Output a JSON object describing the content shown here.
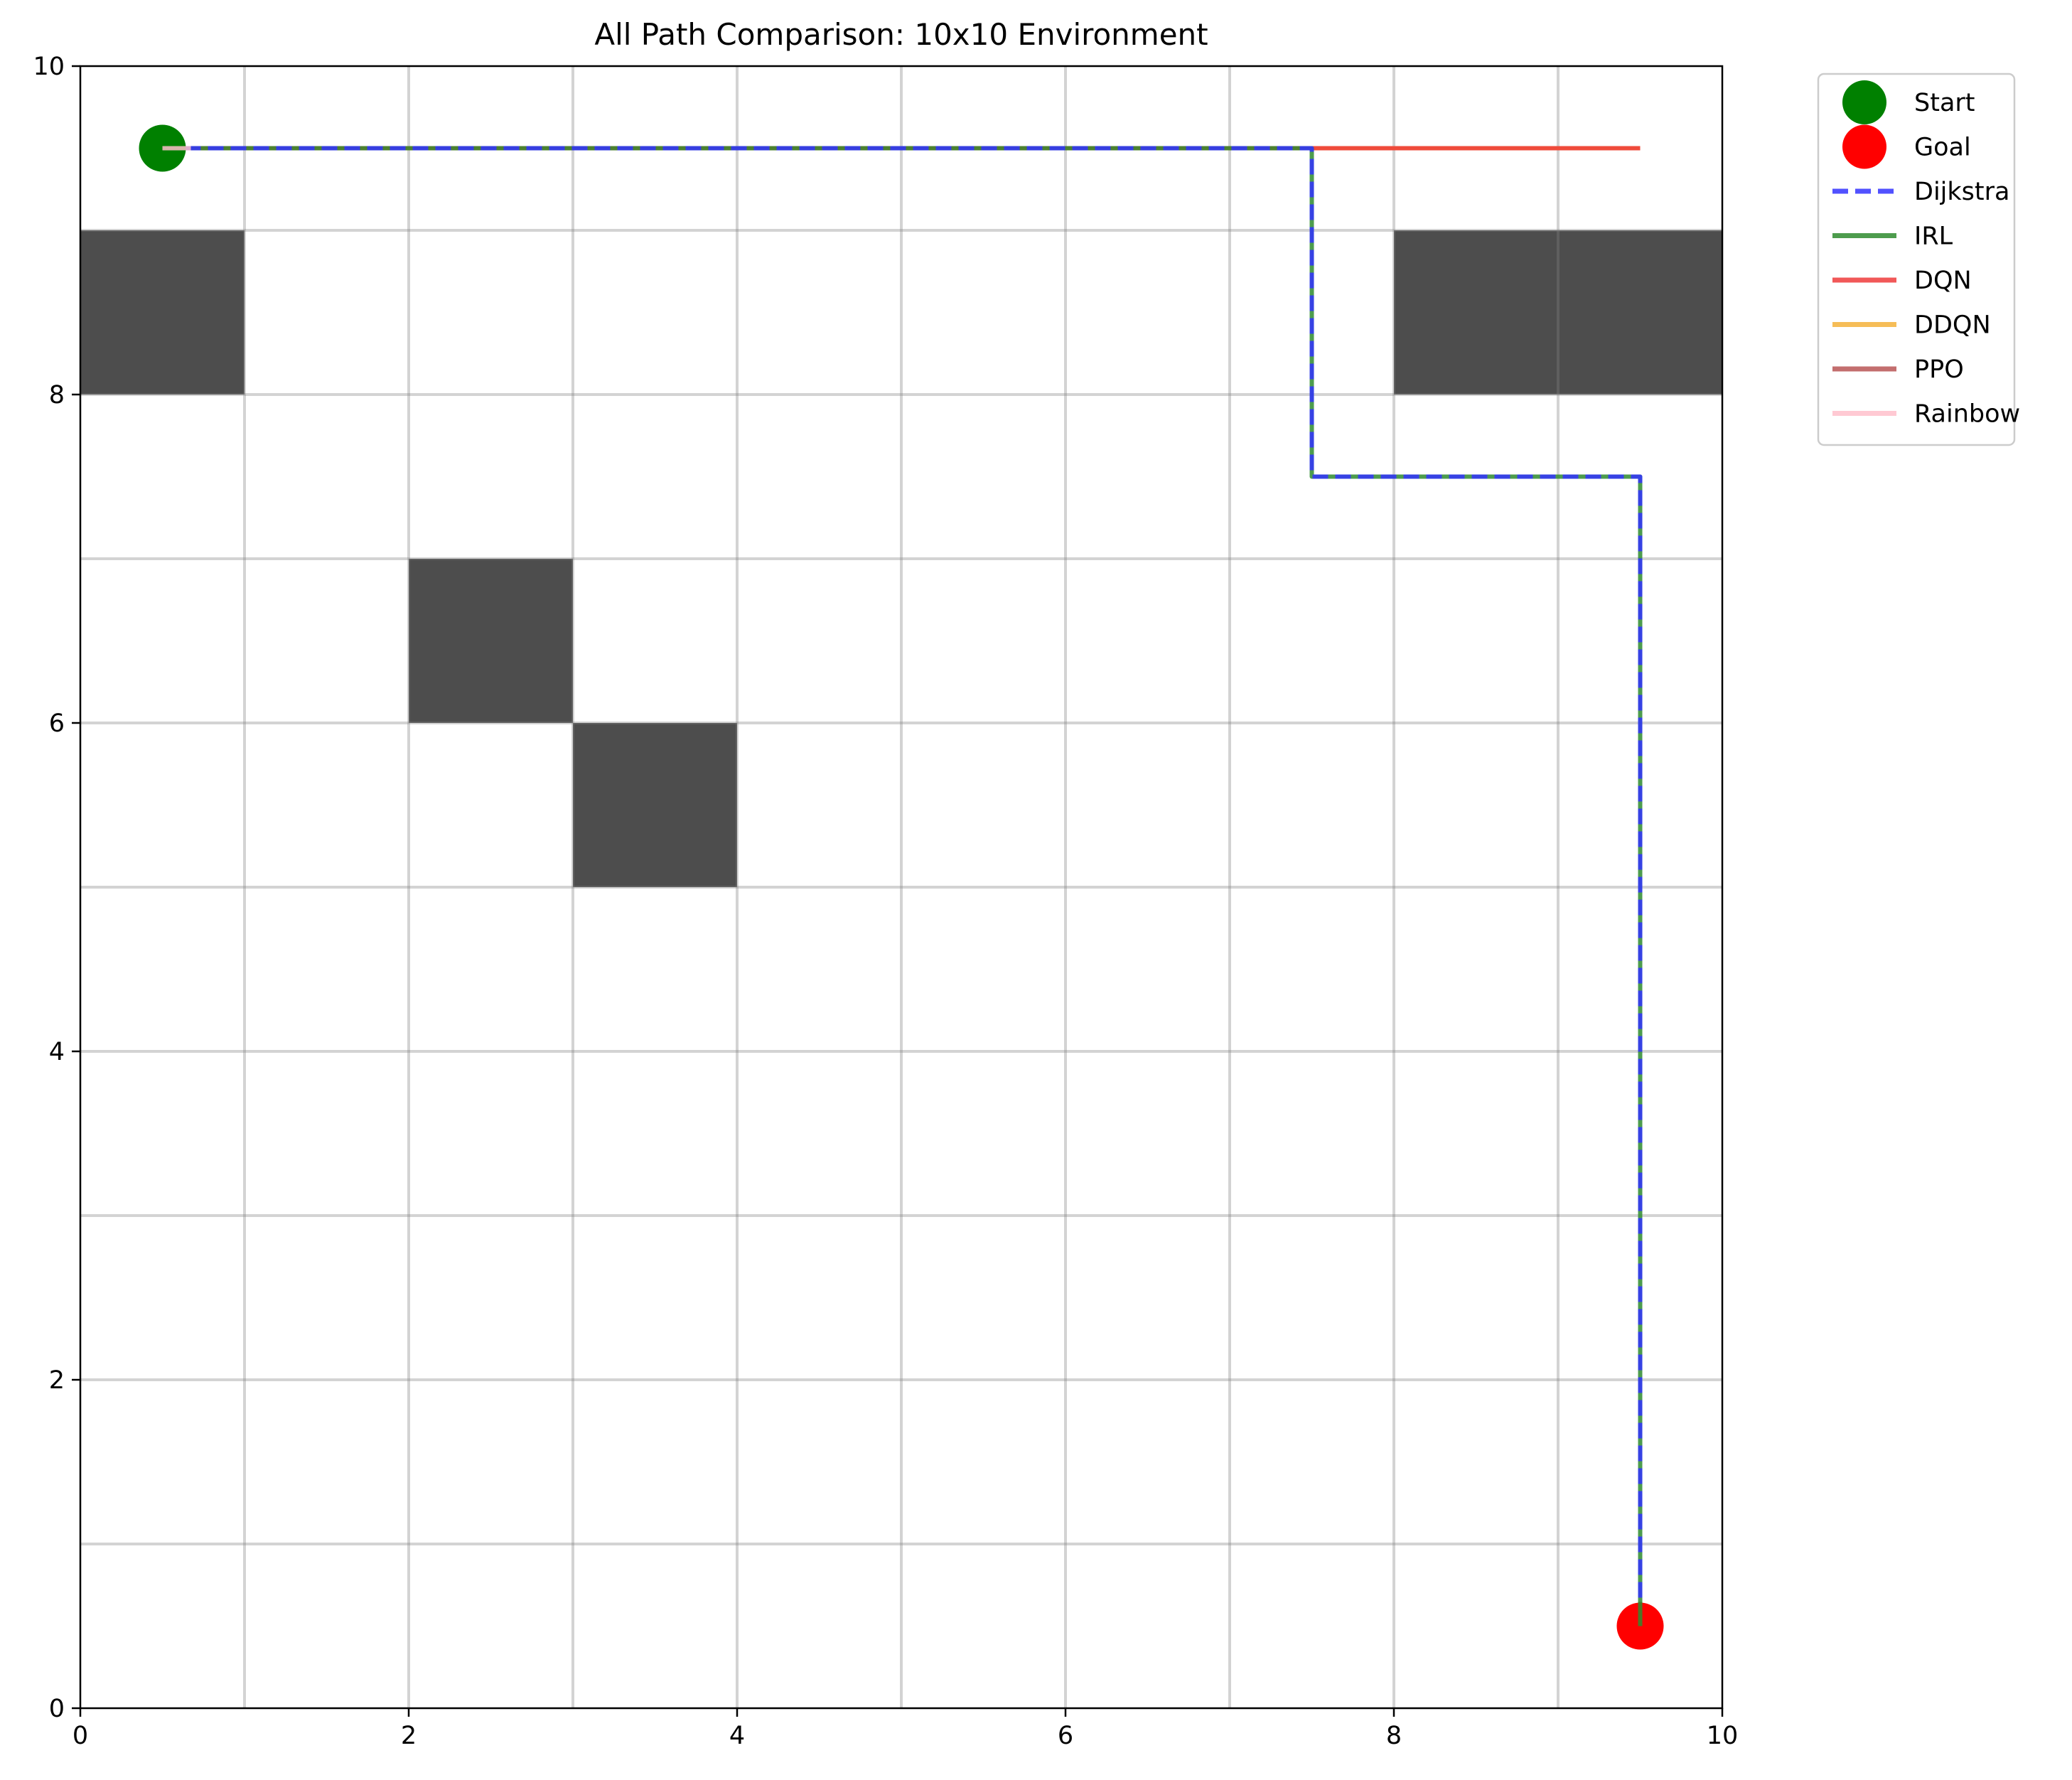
{
  "chart_data": {
    "type": "line",
    "title": "All Path Comparison: 10x10 Environment",
    "xlabel": "",
    "ylabel": "",
    "xlim": [
      0,
      10
    ],
    "ylim": [
      0,
      10
    ],
    "xticks": [
      "0",
      "2",
      "4",
      "6",
      "8",
      "10"
    ],
    "yticks": [
      "0",
      "2",
      "4",
      "6",
      "8",
      "10"
    ],
    "grid": true,
    "grid_step": 1,
    "legend_position": "outside-upper-right",
    "obstacles": [
      {
        "x": 0,
        "y": 8,
        "w": 1,
        "h": 1
      },
      {
        "x": 8,
        "y": 8,
        "w": 2,
        "h": 1
      },
      {
        "x": 2,
        "y": 6,
        "w": 1,
        "h": 1
      },
      {
        "x": 3,
        "y": 5,
        "w": 1,
        "h": 1
      }
    ],
    "obstacle_color": "#4d4d4d",
    "start": {
      "label": "Start",
      "x": 0.5,
      "y": 9.5,
      "color": "#008000"
    },
    "goal": {
      "label": "Goal",
      "x": 9.5,
      "y": 0.5,
      "color": "#ff0000"
    },
    "series": [
      {
        "name": "Dijkstra",
        "color": "#3333ff",
        "dashed": true,
        "x": [
          0.5,
          7.5,
          7.5,
          9.5,
          9.5
        ],
        "y": [
          9.5,
          9.5,
          7.5,
          7.5,
          0.5
        ]
      },
      {
        "name": "IRL",
        "color": "#2e8b2e",
        "dashed": false,
        "x": [
          0.5,
          7.5,
          7.5,
          9.5,
          9.5
        ],
        "y": [
          9.5,
          9.5,
          7.5,
          7.5,
          0.5
        ]
      },
      {
        "name": "DQN",
        "color": "#ee3b3b",
        "dashed": false,
        "x": [
          0.5,
          9.5
        ],
        "y": [
          9.5,
          9.5
        ]
      },
      {
        "name": "DDQN",
        "color": "#f4b13a",
        "dashed": false,
        "x": [
          0.5,
          9.5
        ],
        "y": [
          9.5,
          9.5
        ]
      },
      {
        "name": "PPO",
        "color": "#b85555",
        "dashed": false,
        "x": [
          0.5,
          9.5
        ],
        "y": [
          9.5,
          9.5
        ]
      },
      {
        "name": "Rainbow",
        "color": "#ffc0cb",
        "dashed": false,
        "x": [
          0.5,
          9.5
        ],
        "y": [
          9.5,
          9.5
        ]
      }
    ]
  }
}
